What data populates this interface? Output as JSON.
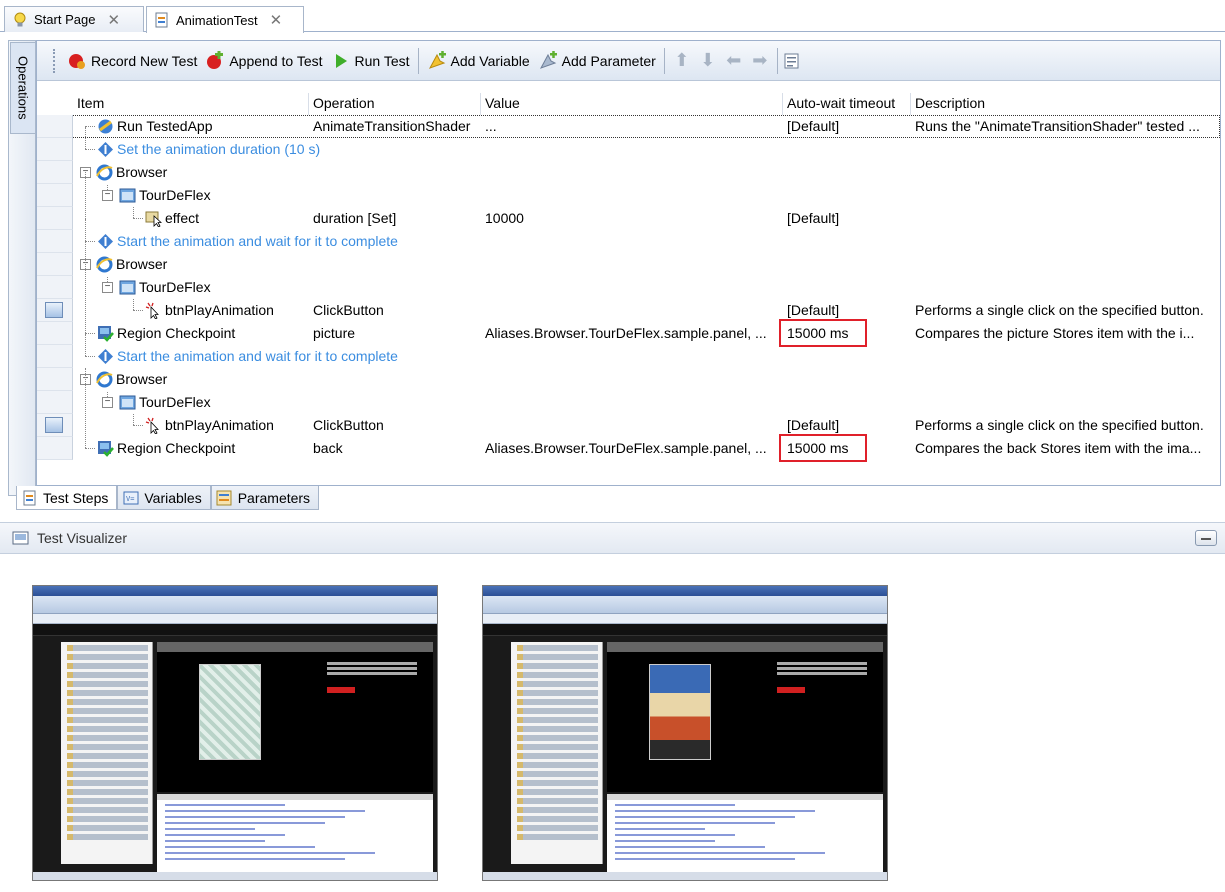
{
  "tabs": [
    {
      "label": "Start Page",
      "active": false
    },
    {
      "label": "AnimationTest",
      "active": true
    }
  ],
  "side_panel": {
    "label": "Operations"
  },
  "toolbar": {
    "record_label": "Record New Test",
    "append_label": "Append to Test",
    "run_label": "Run Test",
    "add_variable_label": "Add Variable",
    "add_parameter_label": "Add Parameter"
  },
  "grid": {
    "columns": [
      "Item",
      "Operation",
      "Value",
      "Auto-wait timeout",
      "Description"
    ],
    "rows": [
      {
        "item": "Run TestedApp",
        "operation": "AnimateTransitionShader",
        "value": "...",
        "wait": "[Default]",
        "description": "Runs the \"AnimateTransitionShader\" tested ..."
      },
      {
        "item": "Set the animation duration (10 s)",
        "operation": "",
        "value": "",
        "wait": "",
        "description": ""
      },
      {
        "item": "Browser",
        "operation": "",
        "value": "",
        "wait": "",
        "description": ""
      },
      {
        "item": "TourDeFlex",
        "operation": "",
        "value": "",
        "wait": "",
        "description": ""
      },
      {
        "item": "effect",
        "operation": "duration [Set]",
        "value": "10000",
        "wait": "[Default]",
        "description": ""
      },
      {
        "item": "Start the animation and wait for it to complete",
        "operation": "",
        "value": "",
        "wait": "",
        "description": ""
      },
      {
        "item": "Browser",
        "operation": "",
        "value": "",
        "wait": "",
        "description": ""
      },
      {
        "item": "TourDeFlex",
        "operation": "",
        "value": "",
        "wait": "",
        "description": ""
      },
      {
        "item": "btnPlayAnimation",
        "operation": "ClickButton",
        "value": "",
        "wait": "[Default]",
        "description": "Performs a single click on the specified button."
      },
      {
        "item": "Region Checkpoint",
        "operation": "picture",
        "value": "Aliases.Browser.TourDeFlex.sample.panel, ...",
        "wait": "15000 ms",
        "description": "Compares the picture Stores item with the i..."
      },
      {
        "item": "Start the animation and wait for it to complete",
        "operation": "",
        "value": "",
        "wait": "",
        "description": ""
      },
      {
        "item": "Browser",
        "operation": "",
        "value": "",
        "wait": "",
        "description": ""
      },
      {
        "item": "TourDeFlex",
        "operation": "",
        "value": "",
        "wait": "",
        "description": ""
      },
      {
        "item": "btnPlayAnimation",
        "operation": "ClickButton",
        "value": "",
        "wait": "[Default]",
        "description": "Performs a single click on the specified button."
      },
      {
        "item": "Region Checkpoint",
        "operation": "back",
        "value": "Aliases.Browser.TourDeFlex.sample.panel, ...",
        "wait": "15000 ms",
        "description": "Compares the back Stores item with the ima..."
      }
    ]
  },
  "bottom_tabs": [
    "Test Steps",
    "Variables",
    "Parameters"
  ],
  "visualizer": {
    "title": "Test Visualizer"
  },
  "colors": {
    "comment": "#3b8de0",
    "highlight": "#e0202a",
    "accent": "#2b4f95"
  }
}
